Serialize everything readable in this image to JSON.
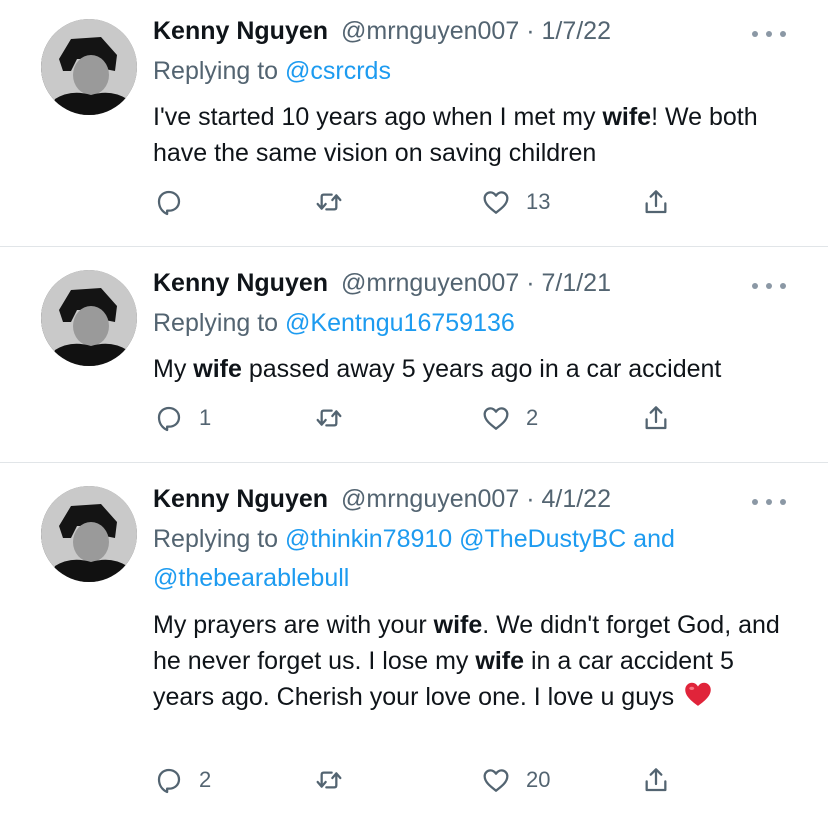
{
  "tweets": [
    {
      "name": "Kenny Nguyen",
      "handle": "@mrnguyen007",
      "dot": "·",
      "date": "1/7/22",
      "replying_prefix": "Replying to ",
      "replying_to": "@csrcrds",
      "body_parts": [
        "I've started 10 years ago when I met my ",
        "wife",
        "! We both have the same vision on saving children"
      ],
      "reply_count": "",
      "like_count": "13"
    },
    {
      "name": "Kenny Nguyen",
      "handle": "@mrnguyen007",
      "dot": "·",
      "date": "7/1/21",
      "replying_prefix": "Replying to ",
      "replying_to": "@Kentngu16759136",
      "body_parts": [
        "My ",
        "wife",
        " passed away 5 years ago in a car accident"
      ],
      "reply_count": "1",
      "like_count": "2"
    },
    {
      "name": "Kenny Nguyen",
      "handle": "@mrnguyen007",
      "dot": "·",
      "date": "4/1/22",
      "replying_prefix": "Replying to ",
      "replying_to": "@thinkin78910 @TheDustyBC and",
      "replying_to_line2": "@thebearablebull",
      "body_parts": [
        "My prayers are with your ",
        "wife",
        ". We didn't forget God, and he never forget us. I lose my ",
        "wife",
        " in a car accident 5 years ago. Cherish your love one. I love u guys"
      ],
      "reply_count": "2",
      "like_count": "20"
    }
  ],
  "icons": [
    "reply-icon",
    "retweet-icon",
    "like-icon",
    "share-icon",
    "more-icon"
  ],
  "colors": {
    "link": "#1d9bf0",
    "secondary": "#536471",
    "divider": "#e1e5e8",
    "heart_emoji": "#e0243a"
  }
}
